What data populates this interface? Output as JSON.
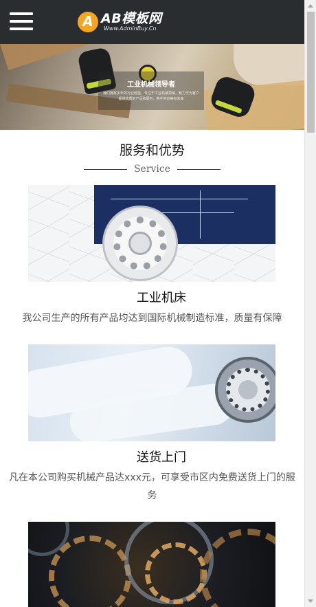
{
  "header": {
    "logo_title": "AB模板网",
    "logo_sub": "Www.AdminBuy.Cn"
  },
  "banner": {
    "caption_title": "工业机械领导者",
    "caption_text": "我们拥有多年的行业经验，专注于工业机械领域，致力于为客户提供优质的产品和服务，携手共创美好未来"
  },
  "section": {
    "title": "服务和优势",
    "subtitle": "Service"
  },
  "services": [
    {
      "title": "工业机床",
      "desc": "我公司生产的所有产品均达到国际机械制造标准，质量有保障"
    },
    {
      "title": "送货上门",
      "desc": "凡在本公司购买机械产品达xxx元，可享受市区内免费送货上门的服务"
    }
  ],
  "colors": {
    "header_bg": "#2a2d30",
    "logo_accent": "#f5a623"
  },
  "icons": {
    "menu": "hamburger-menu-icon",
    "logo": "ab-logo-icon"
  }
}
